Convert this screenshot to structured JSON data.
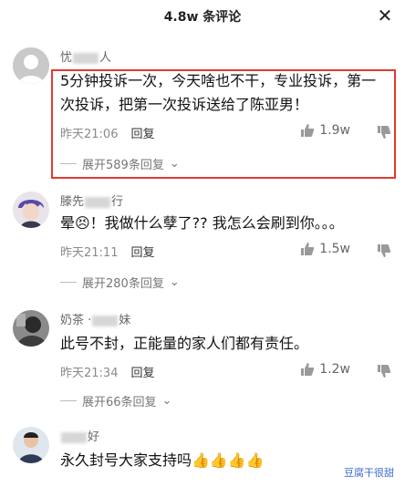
{
  "header": {
    "title": "4.8w 条评论",
    "close_icon": "close-icon"
  },
  "comments": [
    {
      "user_start": "忧",
      "user_end": "人",
      "text": "5分钟投诉一次，今天啥也不干，专业投诉，第一次投诉，把第一次投诉送给了陈亚男！",
      "time": "昨天21:06",
      "reply_label": "回复",
      "likes": "1.9w",
      "expand": "展开589条回复"
    },
    {
      "user_start": "滕先",
      "user_end": "行",
      "text": "晕😣！我做什么孽了?? 我怎么会刷到你。。。",
      "time": "昨天21:11",
      "reply_label": "回复",
      "likes": "1.5w",
      "expand": "展开280条回复"
    },
    {
      "user_start": "奶茶 ·",
      "user_end": "妹",
      "text": "此号不封，正能量的家人们都有责任。",
      "time": "昨天21:34",
      "reply_label": "回复",
      "likes": "1.2w",
      "expand": "展开66条回复"
    },
    {
      "user_start": "",
      "user_end": "好",
      "text": "永久封号大家支持吗👍👍👍👍",
      "time": "",
      "reply_label": "",
      "likes": "",
      "expand": ""
    }
  ],
  "watermark": "豆腐干很甜",
  "colors": {
    "highlight_border": "#e23b2e",
    "watermark_text": "#3a6bd0"
  }
}
